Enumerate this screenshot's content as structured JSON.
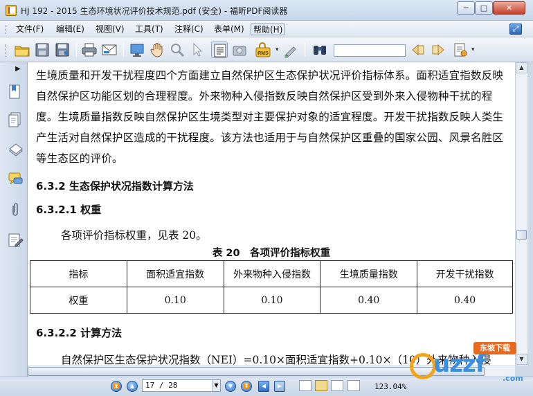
{
  "window": {
    "title": "HJ 192 - 2015 生态环境状况评价技术规范.pdf (安全) - 福昕PDF阅读器",
    "minimize": "─",
    "maximize": "□",
    "close": "✕"
  },
  "menu": {
    "items": [
      {
        "label": "文件(F)"
      },
      {
        "label": "编辑(E)"
      },
      {
        "label": "视图(V)"
      },
      {
        "label": "工具(T)"
      },
      {
        "label": "注释(C)"
      },
      {
        "label": "表单(M)"
      },
      {
        "label": "帮助(H)"
      }
    ],
    "active_index": 6
  },
  "toolbar": {
    "icons": [
      "open-folder-icon",
      "save-icon",
      "save-as-icon",
      "print-icon",
      "email-icon",
      "fullscreen-icon",
      "hand-tool-icon",
      "zoom-tool-icon",
      "select-tool-icon",
      "text-select-icon",
      "snapshot-icon",
      "rms-icon",
      "sign-icon",
      "find-icon",
      "prev-result-icon",
      "next-result-icon",
      "search-options-icon"
    ],
    "search_value": "",
    "rms_label": "RMS"
  },
  "document": {
    "para1": "生境质量和开发干扰程度四个方面建立自然保护区生态保护状况评价指标体系。面积适宜指数反映自然保护区功能区划的合理程度。外来物种入侵指数反映自然保护区受到外来入侵物种干扰的程度。生境质量指数反映自然保护区生境类型对主要保护对象的适宜程度。开发干扰指数反映人类生产生活对自然保护区造成的干扰程度。该方法也适用于与自然保护区重叠的国家公园、风景名胜区等生态区的评价。",
    "heading_632": "6.3.2 生态保护状况指数计算方法",
    "heading_6321": "6.3.2.1 权重",
    "weights_text": "各项评价指标权重，见表 20。",
    "table_caption": "表 20　各项评价指标权重",
    "table": {
      "headers": [
        "指标",
        "面积适宜指数",
        "外来物种入侵指数",
        "生境质量指数",
        "开发干扰指数"
      ],
      "row": [
        "权重",
        "0.10",
        "0.10",
        "0.40",
        "0.40"
      ]
    },
    "heading_6322": "6.3.2.2  计算方法",
    "formula_text": "自然保护区生态保护状况指数（NEI）=0.10×面积适宜指数+0.10×（10）外来物种入侵"
  },
  "statusbar": {
    "page_value": "17 / 28",
    "zoom": "123.04%"
  },
  "watermark": {
    "logo": "uzzf",
    "badge": "东坡下载",
    "com": ".com"
  }
}
